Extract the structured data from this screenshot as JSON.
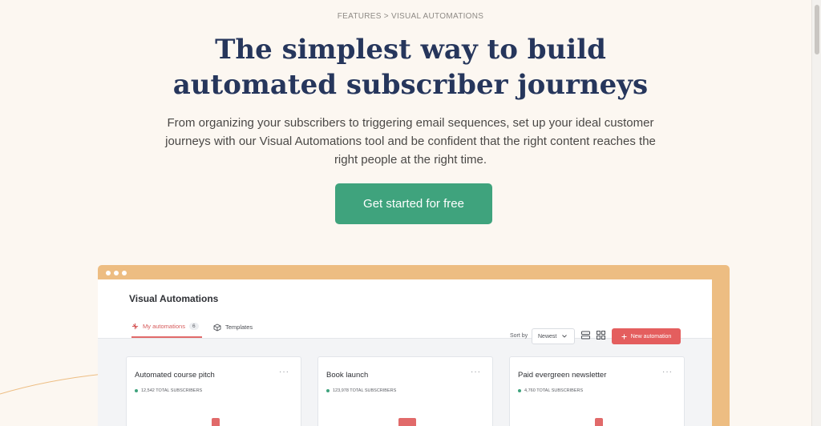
{
  "breadcrumb": "FEATURES > VISUAL AUTOMATIONS",
  "hero": {
    "title": "The simplest way to build automated subscriber journeys",
    "subtitle": "From organizing your subscribers to triggering email sequences, set up your ideal customer journeys with our Visual Automations tool and be confident that the right content reaches the right people at the right time.",
    "cta_label": "Get started for free"
  },
  "app": {
    "title": "Visual Automations",
    "tabs": [
      {
        "label": "My automations",
        "count": "6",
        "active": true
      },
      {
        "label": "Templates",
        "active": false
      }
    ],
    "sort_label": "Sort by",
    "sort_value": "Newest",
    "new_button": "New automation",
    "cards": [
      {
        "title": "Automated course pitch",
        "subscribers": "12,542 TOTAL SUBSCRIBERS"
      },
      {
        "title": "Book launch",
        "subscribers": "123,978 TOTAL SUBSCRIBERS"
      },
      {
        "title": "Paid evergreen newsletter",
        "subscribers": "4,760 TOTAL SUBSCRIBERS"
      }
    ],
    "more_glyph": "···"
  },
  "colors": {
    "background": "#fcf7f1",
    "title": "#26365c",
    "cta": "#3fa37d",
    "frame": "#edbd82",
    "accent_red": "#e45e5e"
  },
  "icons": {
    "tab_mine": "automation-icon",
    "tab_templates": "cube-icon",
    "sort": "chevron-down-icon",
    "view_list": "list-view-icon",
    "view_grid": "grid-view-icon",
    "new": "plus-icon"
  }
}
